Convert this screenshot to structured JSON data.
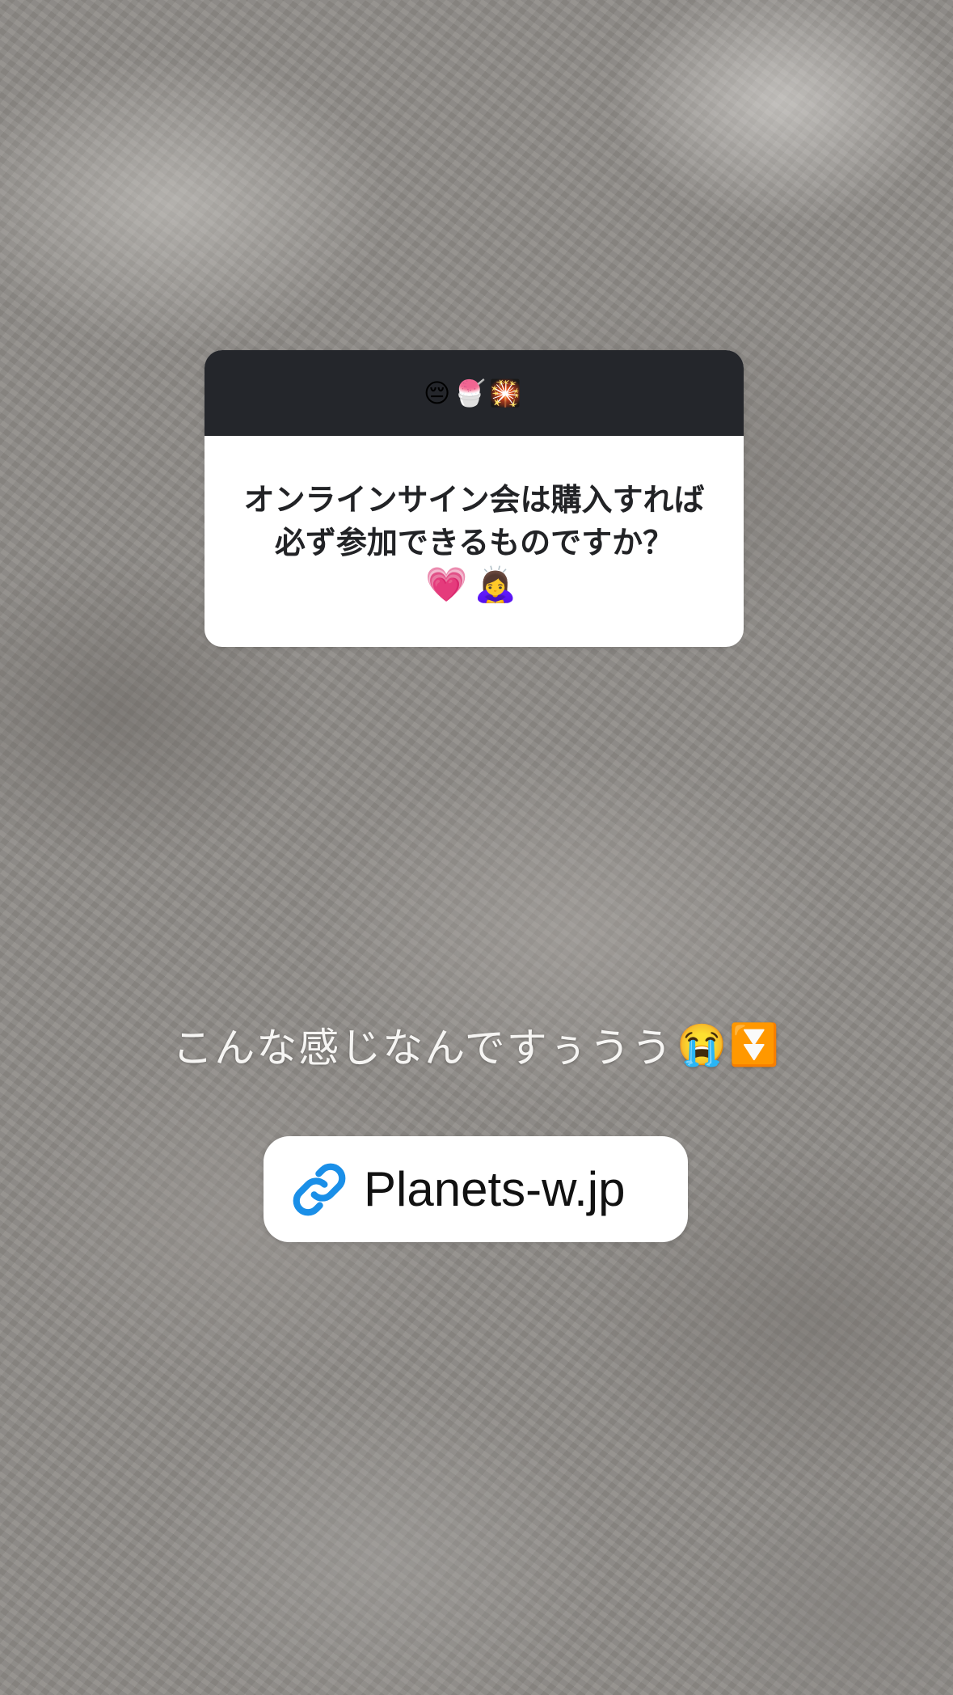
{
  "question_sticker": {
    "header_emojis": "😔🍧🎇",
    "question_text": "オンラインサイン会は購入すれば必ず参加できるものですか？",
    "question_emojis": "💗🙇‍♀️"
  },
  "caption": {
    "text": "こんな感じなんですぅうう",
    "emojis": "😭⏬"
  },
  "link_sticker": {
    "icon": "link-icon",
    "label": "Planets-w.jp",
    "icon_color": "#1a8fe8"
  }
}
